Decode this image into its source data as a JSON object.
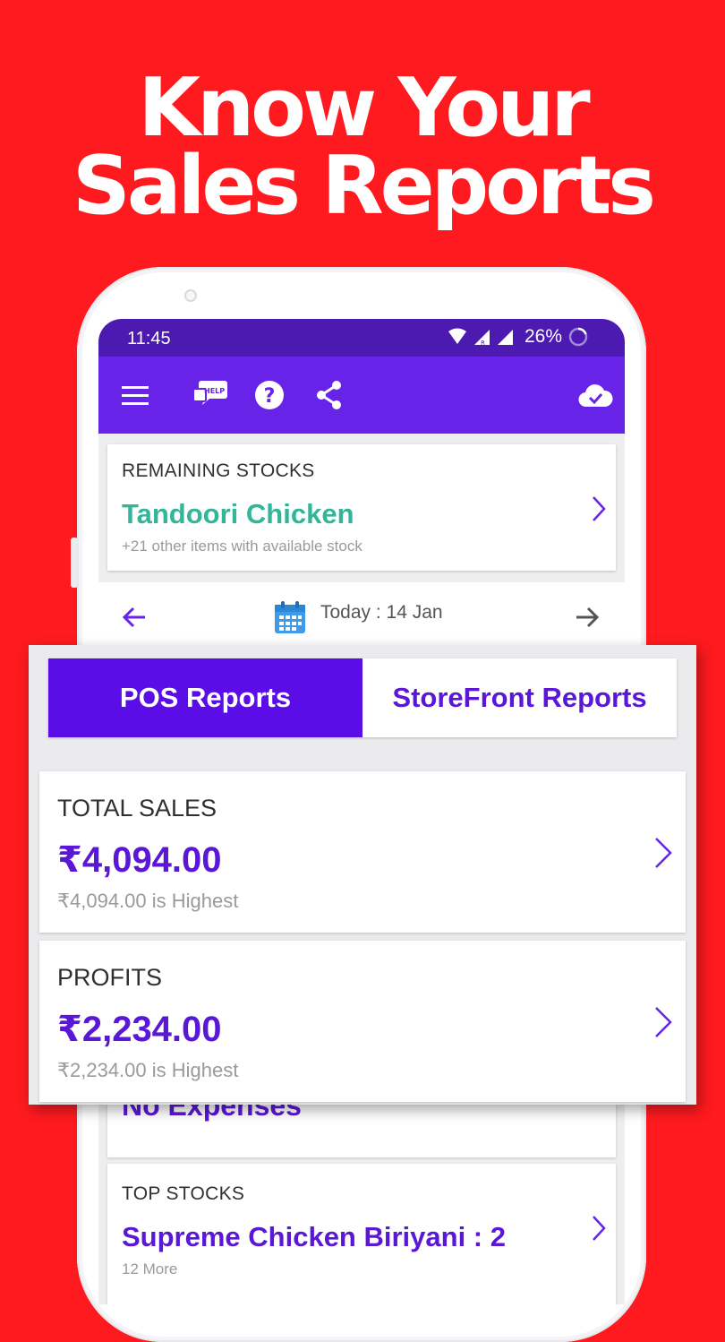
{
  "headline": {
    "line1": "Know Your",
    "line2": "Sales Reports"
  },
  "status_bar": {
    "time": "11:45",
    "battery": "26%"
  },
  "app_bar": {
    "icons": [
      "menu-icon",
      "help-chat-icon",
      "question-icon",
      "share-icon",
      "cloud-sync-icon"
    ],
    "help_badge": "HELP"
  },
  "remaining_stocks": {
    "label": "REMAINING STOCKS",
    "item": "Tandoori Chicken",
    "note": "+21 other items with available stock"
  },
  "date_nav": {
    "label": "Today : 14 Jan"
  },
  "tabs": {
    "active": "POS Reports",
    "inactive": "StoreFront Reports"
  },
  "total_sales": {
    "label": "TOTAL SALES",
    "amount": "₹4,094.00",
    "note": "₹4,094.00 is Highest"
  },
  "profits": {
    "label": "PROFITS",
    "amount": "₹2,234.00",
    "note": "₹2,234.00 is Highest"
  },
  "expenses": {
    "value": "No Expenses"
  },
  "top_stocks": {
    "label": "TOP STOCKS",
    "item": "Supreme Chicken Biriyani  : 2",
    "note": "12 More"
  },
  "colors": {
    "background": "#fe1a1f",
    "status_bar": "#4c1ab1",
    "app_bar": "#6723e8",
    "accent_purple": "#5a18d6",
    "accent_green": "#33b59a",
    "tab_active": "#5a0de6"
  }
}
